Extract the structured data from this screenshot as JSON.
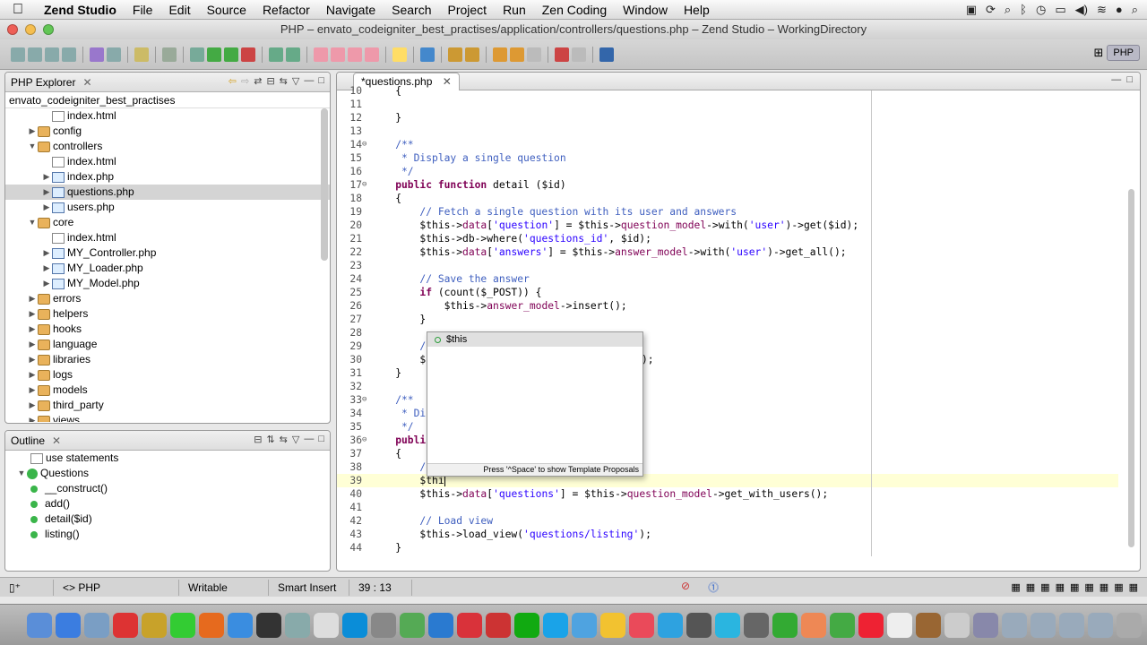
{
  "menubar": {
    "app_name": "Zend Studio",
    "items": [
      "File",
      "Edit",
      "Source",
      "Refactor",
      "Navigate",
      "Search",
      "Project",
      "Run",
      "Zen Coding",
      "Window",
      "Help"
    ]
  },
  "window": {
    "title": "PHP – envato_codeigniter_best_practises/application/controllers/questions.php – Zend Studio – WorkingDirectory"
  },
  "perspective": {
    "label": "PHP"
  },
  "explorer": {
    "tab_label": "PHP Explorer",
    "root": "envato_codeigniter_best_practises",
    "items": [
      {
        "label": "index.html",
        "type": "file",
        "depth": 2,
        "expand": ""
      },
      {
        "label": "config",
        "type": "folder",
        "depth": 1,
        "expand": "▶"
      },
      {
        "label": "controllers",
        "type": "folder",
        "depth": 1,
        "expand": "▼"
      },
      {
        "label": "index.html",
        "type": "file",
        "depth": 2,
        "expand": ""
      },
      {
        "label": "index.php",
        "type": "php",
        "depth": 2,
        "expand": "▶"
      },
      {
        "label": "questions.php",
        "type": "php",
        "depth": 2,
        "expand": "▶",
        "selected": true
      },
      {
        "label": "users.php",
        "type": "php",
        "depth": 2,
        "expand": "▶"
      },
      {
        "label": "core",
        "type": "folder",
        "depth": 1,
        "expand": "▼"
      },
      {
        "label": "index.html",
        "type": "file",
        "depth": 2,
        "expand": ""
      },
      {
        "label": "MY_Controller.php",
        "type": "php",
        "depth": 2,
        "expand": "▶"
      },
      {
        "label": "MY_Loader.php",
        "type": "php",
        "depth": 2,
        "expand": "▶"
      },
      {
        "label": "MY_Model.php",
        "type": "php",
        "depth": 2,
        "expand": "▶"
      },
      {
        "label": "errors",
        "type": "folder",
        "depth": 1,
        "expand": "▶"
      },
      {
        "label": "helpers",
        "type": "folder",
        "depth": 1,
        "expand": "▶"
      },
      {
        "label": "hooks",
        "type": "folder",
        "depth": 1,
        "expand": "▶"
      },
      {
        "label": "language",
        "type": "folder",
        "depth": 1,
        "expand": "▶"
      },
      {
        "label": "libraries",
        "type": "folder",
        "depth": 1,
        "expand": "▶"
      },
      {
        "label": "logs",
        "type": "folder",
        "depth": 1,
        "expand": "▶"
      },
      {
        "label": "models",
        "type": "folder",
        "depth": 1,
        "expand": "▶"
      },
      {
        "label": "third_party",
        "type": "folder",
        "depth": 1,
        "expand": "▶"
      },
      {
        "label": "views",
        "type": "folder",
        "depth": 1,
        "expand": "▶"
      }
    ]
  },
  "outline": {
    "tab_label": "Outline",
    "use_statements": "use statements",
    "class_name": "Questions",
    "methods": [
      "__construct()",
      "add()",
      "detail($id)",
      "listing()"
    ]
  },
  "editor": {
    "tab_label": "*questions.php",
    "lines": [
      {
        "n": "10",
        "fold": "",
        "segs": [
          [
            "plain",
            "    {"
          ]
        ]
      },
      {
        "n": "11",
        "fold": "",
        "segs": [
          [
            "plain",
            "    "
          ]
        ]
      },
      {
        "n": "12",
        "fold": "",
        "segs": [
          [
            "plain",
            "    }"
          ]
        ]
      },
      {
        "n": "13",
        "fold": "",
        "segs": [
          [
            "plain",
            ""
          ]
        ]
      },
      {
        "n": "14",
        "fold": "⊖",
        "segs": [
          [
            "comment",
            "    /**"
          ]
        ]
      },
      {
        "n": "15",
        "fold": "",
        "segs": [
          [
            "comment",
            "     * Display a single question"
          ]
        ]
      },
      {
        "n": "16",
        "fold": "",
        "segs": [
          [
            "comment",
            "     */"
          ]
        ]
      },
      {
        "n": "17",
        "fold": "⊖",
        "segs": [
          [
            "kw",
            "    public function"
          ],
          [
            "plain",
            " detail ($id)"
          ]
        ]
      },
      {
        "n": "18",
        "fold": "",
        "segs": [
          [
            "plain",
            "    {"
          ]
        ]
      },
      {
        "n": "19",
        "fold": "",
        "segs": [
          [
            "comment",
            "        // Fetch a single question with its user and answers"
          ]
        ]
      },
      {
        "n": "20",
        "fold": "",
        "segs": [
          [
            "plain",
            "        $this->"
          ],
          [
            "meth",
            "data"
          ],
          [
            "plain",
            "["
          ],
          [
            "str",
            "'question'"
          ],
          [
            "plain",
            "] = $this->"
          ],
          [
            "meth",
            "question_model"
          ],
          [
            "plain",
            "->with("
          ],
          [
            "str",
            "'user'"
          ],
          [
            "plain",
            ")->get($id);"
          ]
        ]
      },
      {
        "n": "21",
        "fold": "",
        "segs": [
          [
            "plain",
            "        $this->db->where("
          ],
          [
            "str",
            "'questions_id'"
          ],
          [
            "plain",
            ", $id);"
          ]
        ]
      },
      {
        "n": "22",
        "fold": "",
        "segs": [
          [
            "plain",
            "        $this->"
          ],
          [
            "meth",
            "data"
          ],
          [
            "plain",
            "["
          ],
          [
            "str",
            "'answers'"
          ],
          [
            "plain",
            "] = $this->"
          ],
          [
            "meth",
            "answer_model"
          ],
          [
            "plain",
            "->with("
          ],
          [
            "str",
            "'user'"
          ],
          [
            "plain",
            ")->get_all();"
          ]
        ]
      },
      {
        "n": "23",
        "fold": "",
        "segs": [
          [
            "plain",
            ""
          ]
        ]
      },
      {
        "n": "24",
        "fold": "",
        "segs": [
          [
            "comment",
            "        // Save the answer"
          ]
        ]
      },
      {
        "n": "25",
        "fold": "",
        "segs": [
          [
            "kw",
            "        if"
          ],
          [
            "plain",
            " (count($_POST)) {"
          ]
        ]
      },
      {
        "n": "26",
        "fold": "",
        "segs": [
          [
            "plain",
            "            $this->"
          ],
          [
            "meth",
            "answer_model"
          ],
          [
            "plain",
            "->insert();"
          ]
        ]
      },
      {
        "n": "27",
        "fold": "",
        "segs": [
          [
            "plain",
            "        }"
          ]
        ]
      },
      {
        "n": "28",
        "fold": "",
        "segs": [
          [
            "plain",
            ""
          ]
        ]
      },
      {
        "n": "29",
        "fold": "",
        "segs": [
          [
            "comment",
            "        /"
          ]
        ]
      },
      {
        "n": "30",
        "fold": "",
        "segs": [
          [
            "plain",
            "        $"
          ]
        ]
      },
      {
        "n": "31",
        "fold": "",
        "segs": [
          [
            "plain",
            "    }"
          ]
        ]
      },
      {
        "n": "32",
        "fold": "",
        "segs": [
          [
            "plain",
            ""
          ]
        ]
      },
      {
        "n": "33",
        "fold": "⊖",
        "segs": [
          [
            "comment",
            "    /**"
          ]
        ]
      },
      {
        "n": "34",
        "fold": "",
        "segs": [
          [
            "comment",
            "     * Di"
          ]
        ]
      },
      {
        "n": "35",
        "fold": "",
        "segs": [
          [
            "comment",
            "     */"
          ]
        ]
      },
      {
        "n": "36",
        "fold": "⊖",
        "segs": [
          [
            "kw",
            "    publi"
          ]
        ]
      },
      {
        "n": "37",
        "fold": "",
        "segs": [
          [
            "plain",
            "    {"
          ]
        ]
      },
      {
        "n": "38",
        "fold": "",
        "segs": [
          [
            "comment",
            "        /"
          ]
        ]
      },
      {
        "n": "39",
        "fold": "",
        "segs": [
          [
            "plain",
            "        $thi"
          ]
        ],
        "current": true
      },
      {
        "n": "40",
        "fold": "",
        "segs": [
          [
            "plain",
            "        $this->"
          ],
          [
            "meth",
            "data"
          ],
          [
            "plain",
            "["
          ],
          [
            "str",
            "'questions'"
          ],
          [
            "plain",
            "] = $this->"
          ],
          [
            "meth",
            "question_model"
          ],
          [
            "plain",
            "->get_with_users();"
          ]
        ]
      },
      {
        "n": "41",
        "fold": "",
        "segs": [
          [
            "plain",
            ""
          ]
        ]
      },
      {
        "n": "42",
        "fold": "",
        "segs": [
          [
            "comment",
            "        // Load view"
          ]
        ]
      },
      {
        "n": "43",
        "fold": "",
        "segs": [
          [
            "plain",
            "        $this->load_view("
          ],
          [
            "str",
            "'questions/listing'"
          ],
          [
            "plain",
            ");"
          ]
        ]
      },
      {
        "n": "44",
        "fold": "",
        "segs": [
          [
            "plain",
            "    }"
          ]
        ]
      }
    ],
    "line30_tail": ");",
    "autocomplete": {
      "item": "$this",
      "hint": "Press '^Space' to show Template Proposals"
    }
  },
  "statusbar": {
    "language": "PHP",
    "writable": "Writable",
    "insert_mode": "Smart Insert",
    "position": "39 : 13"
  }
}
